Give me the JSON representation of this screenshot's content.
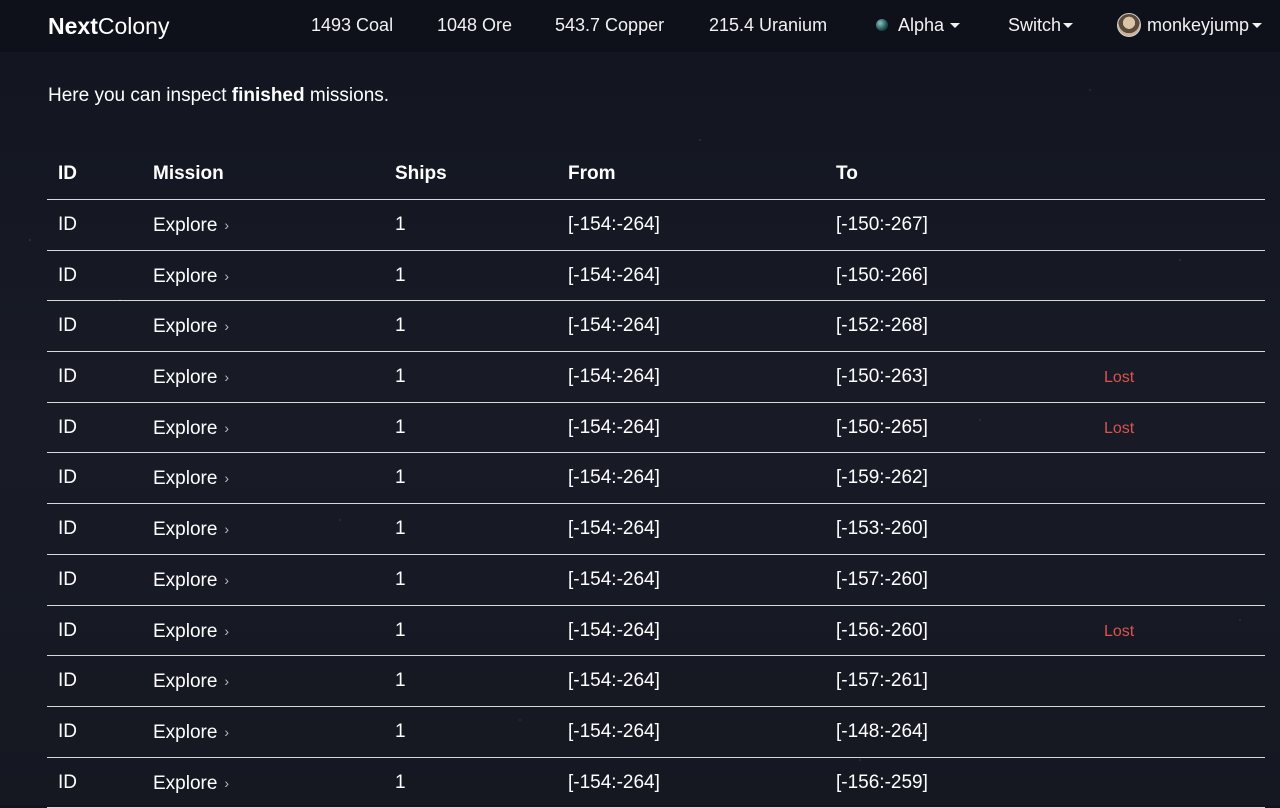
{
  "brand": {
    "bold": "Next",
    "light": "Colony"
  },
  "resources": {
    "coal": "1493 Coal",
    "ore": "1048 Ore",
    "copper": "543.7 Copper",
    "uranium": "215.4 Uranium"
  },
  "planet_menu": {
    "label": "Alpha"
  },
  "switch_menu": {
    "label": "Switch"
  },
  "user_menu": {
    "label": "monkeyjump"
  },
  "intro": {
    "before": "Here you can inspect ",
    "bold": "finished",
    "after": " missions."
  },
  "table": {
    "headers": [
      "ID",
      "Mission",
      "Ships",
      "From",
      "To"
    ],
    "rows": [
      {
        "id": "ID",
        "mission": "Explore",
        "ships": "1",
        "from": "[-154:-264]",
        "to": "[-150:-267]",
        "status": ""
      },
      {
        "id": "ID",
        "mission": "Explore",
        "ships": "1",
        "from": "[-154:-264]",
        "to": "[-150:-266]",
        "status": ""
      },
      {
        "id": "ID",
        "mission": "Explore",
        "ships": "1",
        "from": "[-154:-264]",
        "to": "[-152:-268]",
        "status": ""
      },
      {
        "id": "ID",
        "mission": "Explore",
        "ships": "1",
        "from": "[-154:-264]",
        "to": "[-150:-263]",
        "status": "Lost"
      },
      {
        "id": "ID",
        "mission": "Explore",
        "ships": "1",
        "from": "[-154:-264]",
        "to": "[-150:-265]",
        "status": "Lost"
      },
      {
        "id": "ID",
        "mission": "Explore",
        "ships": "1",
        "from": "[-154:-264]",
        "to": "[-159:-262]",
        "status": ""
      },
      {
        "id": "ID",
        "mission": "Explore",
        "ships": "1",
        "from": "[-154:-264]",
        "to": "[-153:-260]",
        "status": ""
      },
      {
        "id": "ID",
        "mission": "Explore",
        "ships": "1",
        "from": "[-154:-264]",
        "to": "[-157:-260]",
        "status": ""
      },
      {
        "id": "ID",
        "mission": "Explore",
        "ships": "1",
        "from": "[-154:-264]",
        "to": "[-156:-260]",
        "status": "Lost"
      },
      {
        "id": "ID",
        "mission": "Explore",
        "ships": "1",
        "from": "[-154:-264]",
        "to": "[-157:-261]",
        "status": ""
      },
      {
        "id": "ID",
        "mission": "Explore",
        "ships": "1",
        "from": "[-154:-264]",
        "to": "[-148:-264]",
        "status": ""
      },
      {
        "id": "ID",
        "mission": "Explore",
        "ships": "1",
        "from": "[-154:-264]",
        "to": "[-156:-259]",
        "status": ""
      }
    ]
  },
  "icons": {
    "mission_chevron": "chevron-right-icon",
    "planet": "planet-icon",
    "avatar": "avatar-icon"
  },
  "colors": {
    "lost_status": "#d9534f",
    "navbar": "#0e101a",
    "background": "#141620"
  }
}
